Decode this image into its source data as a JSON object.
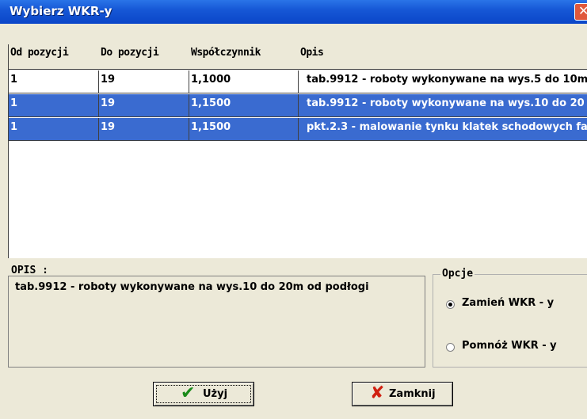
{
  "window": {
    "title": "Wybierz WKR-y",
    "close_glyph": "✕"
  },
  "table": {
    "columns": [
      "Od pozycji",
      "Do pozycji",
      "Współczynnik",
      "Opis"
    ],
    "rows": [
      {
        "od": "1",
        "do": "19",
        "wsp": "1,1000",
        "opis": "tab.9912 - roboty wykonywane na wys.5 do 10m",
        "selected": false
      },
      {
        "od": "1",
        "do": "19",
        "wsp": "1,1500",
        "opis": "tab.9912 - roboty wykonywane na wys.10 do 20",
        "selected": true
      },
      {
        "od": "1",
        "do": "19",
        "wsp": "1,1500",
        "opis": "pkt.2.3 - malowanie tynku klatek schodowych fa",
        "selected": true
      }
    ]
  },
  "opis": {
    "label": "OPIS :",
    "text": "tab.9912 - roboty wykonywane na wys.10 do 20m od podłogi"
  },
  "opcje": {
    "title": "Opcje",
    "options": [
      {
        "label": "Zamień WKR - y",
        "checked": true
      },
      {
        "label": "Pomnóż WKR - y",
        "checked": false
      }
    ]
  },
  "buttons": {
    "uzyj": {
      "label": "Użyj",
      "icon": "check-icon",
      "icon_color": "#1a8a1a"
    },
    "zamknij": {
      "label": "Zamknij",
      "icon": "x-icon",
      "icon_color": "#d02010"
    }
  },
  "colors": {
    "selection": "#3a6bd0",
    "titlebar": "#0a46c8"
  }
}
